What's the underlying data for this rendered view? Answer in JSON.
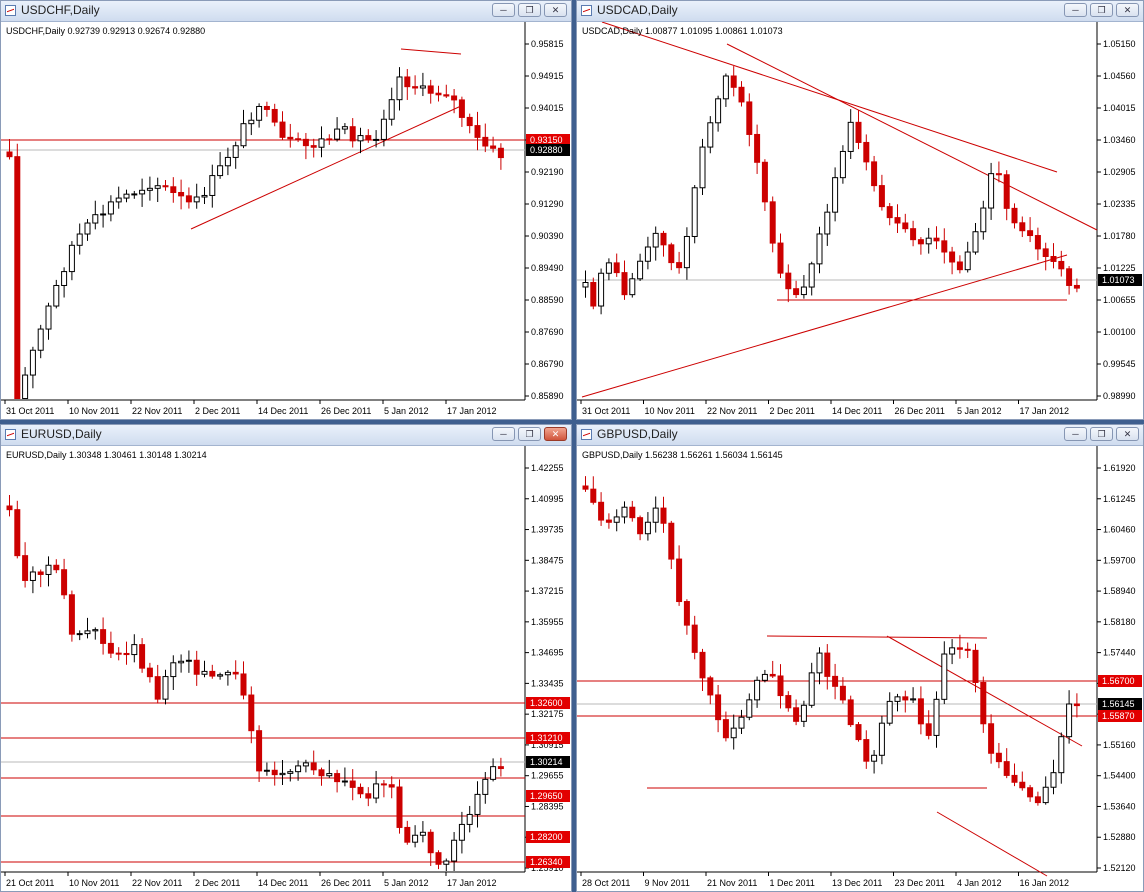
{
  "colors": {
    "up": "#ffffff",
    "down": "#cc0000",
    "line": "#cc0000",
    "grid": "#b8b8b8",
    "axis": "#000000",
    "tag_red": "#e20000",
    "tag_black": "#000000"
  },
  "windows": [
    {
      "id": "usdchf",
      "title": "USDCHF,Daily",
      "info": "USDCHF,Daily  0.92739 0.92913 0.92674 0.92880",
      "active_close": false,
      "price_labels": [
        "0.95815",
        "0.94915",
        "0.94015",
        "0.93115",
        "0.92190",
        "0.91290",
        "0.90390",
        "0.89490",
        "0.88590",
        "0.87690",
        "0.86790",
        "0.85890"
      ],
      "tags": [
        {
          "text": "0.93150",
          "color": "red"
        },
        {
          "text": "0.92880",
          "color": "black"
        }
      ],
      "time_labels": [
        "31 Oct 2011",
        "10 Nov 2011",
        "22 Nov 2011",
        "2 Dec 2011",
        "14 Dec 2011",
        "26 Dec 2011",
        "5 Jan 2012",
        "17 Jan 2012"
      ]
    },
    {
      "id": "usdcad",
      "title": "USDCAD,Daily",
      "info": "USDCAD,Daily  1.00877 1.01095 1.00861 1.01073",
      "active_close": false,
      "price_labels": [
        "1.05150",
        "1.04560",
        "1.04015",
        "1.03460",
        "1.02905",
        "1.02335",
        "1.01780",
        "1.01225",
        "1.00655",
        "1.00100",
        "0.99545",
        "0.98990"
      ],
      "tags": [
        {
          "text": "1.01073",
          "color": "black"
        }
      ],
      "time_labels": [
        "31 Oct 2011",
        "10 Nov 2011",
        "22 Nov 2011",
        "2 Dec 2011",
        "14 Dec 2011",
        "26 Dec 2011",
        "5 Jan 2012",
        "17 Jan 2012"
      ]
    },
    {
      "id": "eurusd",
      "title": "EURUSD,Daily",
      "info": "EURUSD,Daily  1.30348 1.30461 1.30148 1.30214",
      "active_close": true,
      "price_labels": [
        "1.42255",
        "1.40995",
        "1.39735",
        "1.38475",
        "1.37215",
        "1.35955",
        "1.34695",
        "1.33435",
        "1.32175",
        "1.30915",
        "1.29655",
        "1.28395",
        "1.27135",
        "1.25910"
      ],
      "tags": [
        {
          "text": "1.32600",
          "color": "red"
        },
        {
          "text": "1.31210",
          "color": "red"
        },
        {
          "text": "1.30214",
          "color": "black"
        },
        {
          "text": "1.29650",
          "color": "red"
        },
        {
          "text": "1.28200",
          "color": "red"
        },
        {
          "text": "1.26340",
          "color": "red"
        }
      ],
      "time_labels": [
        "21 Oct 2011",
        "10 Nov 2011",
        "22 Nov 2011",
        "2 Dec 2011",
        "14 Dec 2011",
        "26 Dec 2011",
        "5 Jan 2012",
        "17 Jan 2012"
      ]
    },
    {
      "id": "gbpusd",
      "title": "GBPUSD,Daily",
      "info": "GBPUSD,Daily  1.56238 1.56261 1.56034 1.56145",
      "active_close": false,
      "price_labels": [
        "1.61920",
        "1.61245",
        "1.60460",
        "1.59700",
        "1.58940",
        "1.58180",
        "1.57440",
        "1.56700",
        "1.55930",
        "1.55160",
        "1.54400",
        "1.53640",
        "1.52880",
        "1.52120"
      ],
      "tags": [
        {
          "text": "1.56700",
          "color": "red"
        },
        {
          "text": "1.56145",
          "color": "black"
        },
        {
          "text": "1.55870",
          "color": "red"
        }
      ],
      "time_labels": [
        "28 Oct 2011",
        "9 Nov 2011",
        "21 Nov 2011",
        "1 Dec 2011",
        "13 Dec 2011",
        "23 Dec 2011",
        "4 Jan 2012",
        "16 Jan 2012"
      ]
    }
  ]
}
